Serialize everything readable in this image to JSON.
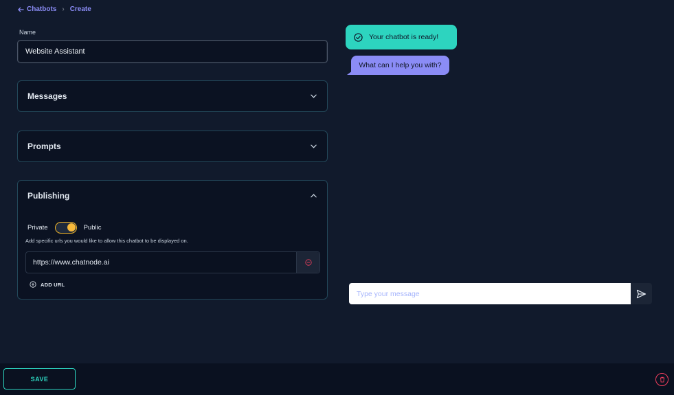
{
  "breadcrumb": {
    "back_label": "Chatbots",
    "current": "Create"
  },
  "form": {
    "name_label": "Name",
    "name_value": "Website Assistant"
  },
  "sections": {
    "messages": {
      "title": "Messages",
      "expanded": false
    },
    "prompts": {
      "title": "Prompts",
      "expanded": false
    },
    "publishing": {
      "title": "Publishing",
      "expanded": true,
      "toggle_left": "Private",
      "toggle_right": "Public",
      "is_public": true,
      "helper_text": "Add specific urls you would like to allow this chatbot to be displayed on.",
      "urls": [
        "https://www.chatnode.ai"
      ],
      "add_url_label": "ADD URL"
    }
  },
  "chat": {
    "ready_message": "Your chatbot is ready!",
    "bot_message": "What can I help you with?",
    "input_placeholder": "Type your message"
  },
  "footer": {
    "save_label": "SAVE"
  },
  "colors": {
    "background": "#111a2c",
    "accent_teal": "#2dd4bf",
    "accent_purple": "#8b8cf6",
    "toggle_yellow": "#f6b93b",
    "danger": "#f43f5e"
  },
  "icons": {
    "back": "arrow-left-icon",
    "chevron": "chevron-down-icon",
    "check": "check-circle-icon",
    "remove": "minus-circle-icon",
    "add": "plus-circle-icon",
    "send": "send-icon",
    "delete": "trash-icon"
  }
}
